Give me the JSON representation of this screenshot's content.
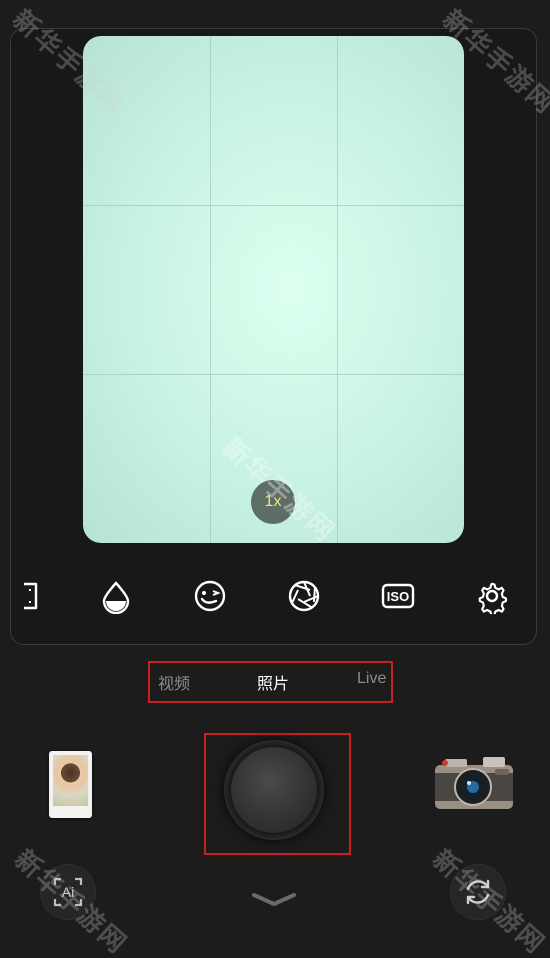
{
  "viewfinder": {
    "zoom_label": "1x",
    "background_color": "#d6f8ea"
  },
  "toolbar": {
    "icons": [
      "aspect-ratio-icon",
      "water-drop-icon",
      "wink-face-icon",
      "aperture-icon",
      "iso-icon",
      "gear-icon"
    ],
    "iso_label": "ISO"
  },
  "modes": {
    "items": [
      {
        "label": "视频",
        "active": false
      },
      {
        "label": "照片",
        "active": true
      },
      {
        "label": "Live",
        "active": false
      }
    ]
  },
  "bottom": {
    "ai_label": "Ai",
    "highlight_color": "#cc1f24"
  },
  "watermark": {
    "text": "新华手游网"
  }
}
